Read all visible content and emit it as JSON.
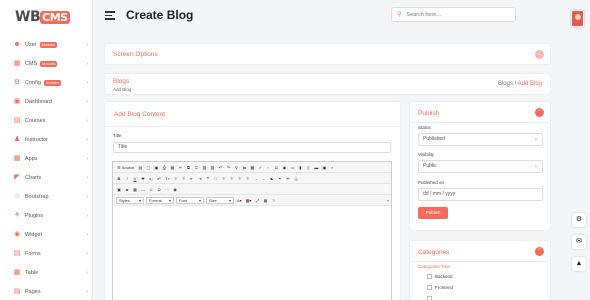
{
  "app": {
    "logo_prefix": "WB",
    "logo_mark": "CMS"
  },
  "header": {
    "title": "Create Blog",
    "search_placeholder": "Search here..."
  },
  "sidebar": {
    "items": [
      {
        "label": "User",
        "badge": "Modules",
        "icon": "user-icon"
      },
      {
        "label": "CMS",
        "badge": "Modules",
        "icon": "cms-icon"
      },
      {
        "label": "Config",
        "badge": "Modules",
        "icon": "config-icon"
      },
      {
        "label": "Dashboard",
        "icon": "dashboard-icon"
      },
      {
        "label": "Courses",
        "icon": "courses-icon"
      },
      {
        "label": "Instructor",
        "icon": "instructor-icon"
      },
      {
        "label": "Apps",
        "icon": "apps-icon"
      },
      {
        "label": "Charts",
        "icon": "charts-icon"
      },
      {
        "label": "Bootstrap",
        "icon": "bootstrap-icon"
      },
      {
        "label": "Plugins",
        "icon": "plugins-icon"
      },
      {
        "label": "Widget",
        "icon": "widget-icon"
      },
      {
        "label": "Forms",
        "icon": "forms-icon"
      },
      {
        "label": "Table",
        "icon": "table-icon"
      },
      {
        "label": "Pages",
        "icon": "pages-icon"
      }
    ]
  },
  "screen_options": {
    "title": "Screen Options"
  },
  "breadcrumb": {
    "title": "Blogs",
    "subtitle": "Add Blog",
    "root": "Blogs",
    "separator": "/",
    "current": "Add Blog"
  },
  "content": {
    "card_title": "Add Blog Content",
    "title_label": "Title",
    "title_placeholder": "Title",
    "editor": {
      "source_label": "Source",
      "styles_label": "Styles",
      "format_label": "Format",
      "font_label": "Font",
      "size_label": "Size"
    }
  },
  "publish": {
    "title": "Publish",
    "status_label": "Status",
    "status_value": "Published",
    "visibility_label": "Visibility",
    "visibility_value": "Public",
    "published_on_label": "Published on",
    "published_on_placeholder": "dd / mm / yyyy",
    "button_label": "Publish"
  },
  "categories": {
    "title": "Categories",
    "tree_label": "Categories Tree",
    "items": [
      "Backend",
      "Frontend"
    ]
  },
  "colors": {
    "accent": "#f26b5b",
    "background": "#f4f5f7"
  }
}
